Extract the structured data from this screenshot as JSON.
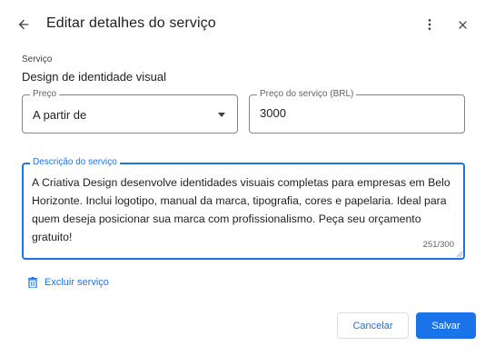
{
  "dialog": {
    "title": "Editar detalhes do serviço"
  },
  "service": {
    "label": "Serviço",
    "value": "Design de identidade visual"
  },
  "price": {
    "label": "Preço",
    "selected": "A partir de"
  },
  "amount": {
    "label": "Preço do serviço (BRL)",
    "value": "3000"
  },
  "description": {
    "label": "Descrição do serviço",
    "text": "A Criativa Design desenvolve identidades visuais completas para empresas em Belo Horizonte. Inclui logotipo, manual da marca, tipografia, cores e papelaria. Ideal para quem deseja posicionar sua marca com profissionalismo. Peça seu orçamento gratuito!",
    "counter": "251/300"
  },
  "actions": {
    "delete_label": "Excluir serviço",
    "cancel_label": "Cancelar",
    "save_label": "Salvar"
  },
  "colors": {
    "accent": "#1a73e8",
    "text": "#202124",
    "border": "#80868b"
  },
  "icons": {
    "back": "arrow-back-icon",
    "more": "more-vert-icon",
    "close": "close-icon",
    "dropdown": "dropdown-arrow-icon",
    "delete": "trash-icon"
  }
}
